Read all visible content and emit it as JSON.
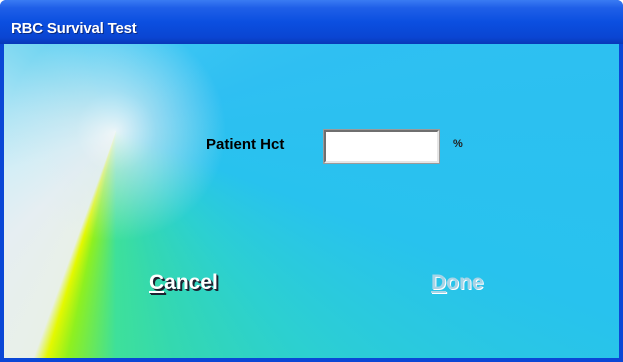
{
  "window": {
    "title": "RBC Survival Test"
  },
  "form": {
    "patient_hct_label": "Patient Hct",
    "patient_hct_value": "",
    "unit": "%"
  },
  "buttons": {
    "cancel": {
      "access_key": "C",
      "rest": "ancel"
    },
    "done": {
      "access_key": "D",
      "rest": "one",
      "enabled": false
    }
  },
  "colors": {
    "titlebar": "#0a47d6",
    "background_accent": "#3fc8f2",
    "done_disabled": "#a8d4e6"
  }
}
